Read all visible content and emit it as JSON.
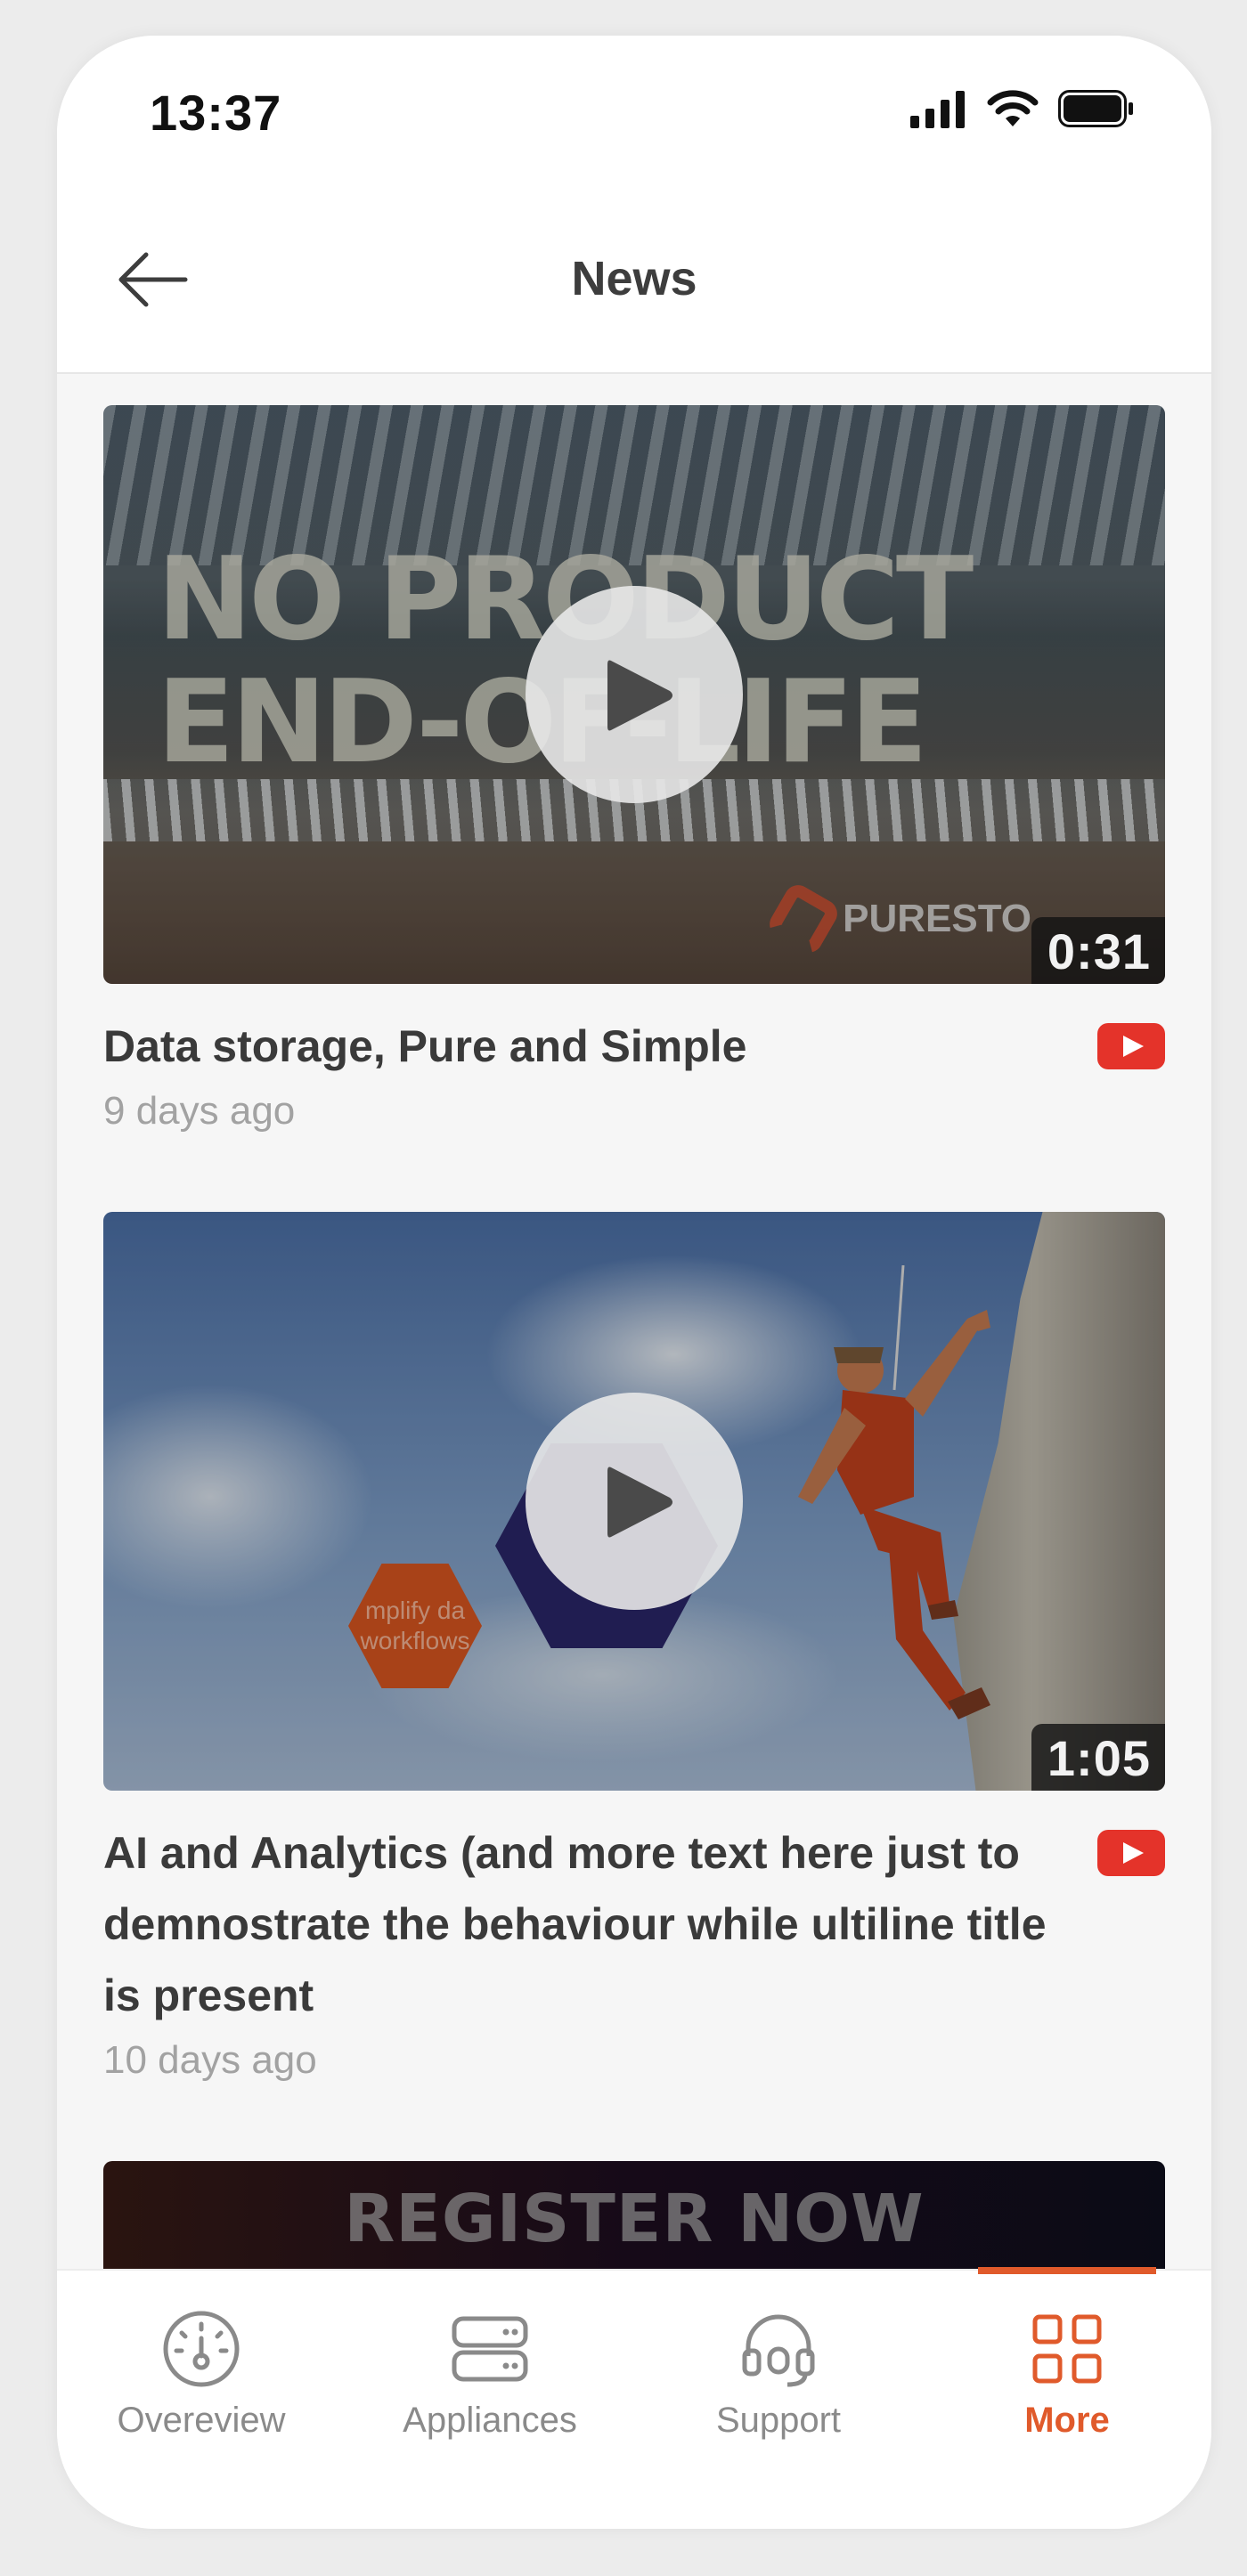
{
  "status_bar": {
    "time": "13:37"
  },
  "header": {
    "title": "News"
  },
  "news": [
    {
      "thumbnail_text": "NO PRODUCT\nEND-OF-LIFE",
      "brand_text": "PURESTO",
      "duration": "0:31",
      "title": "Data storage, Pure and Simple",
      "date": "9 days ago"
    },
    {
      "thumbnail_text": "mplify da\nworkflows",
      "duration": "1:05",
      "title": "AI and Analytics (and more text here just to demnostrate the behaviour while ultiline title is present",
      "date": "10 days ago"
    },
    {
      "thumbnail_text": "REGISTER NOW"
    }
  ],
  "tabs": [
    {
      "label": "Overeview",
      "icon": "gauge-icon",
      "active": false
    },
    {
      "label": "Appliances",
      "icon": "server-icon",
      "active": false
    },
    {
      "label": "Support",
      "icon": "headset-icon",
      "active": false
    },
    {
      "label": "More",
      "icon": "grid-icon",
      "active": true
    }
  ],
  "colors": {
    "accent": "#e05a2b",
    "youtube": "#e4332a",
    "title_text": "#3a3a3a",
    "muted_text": "#a2a2a2"
  }
}
